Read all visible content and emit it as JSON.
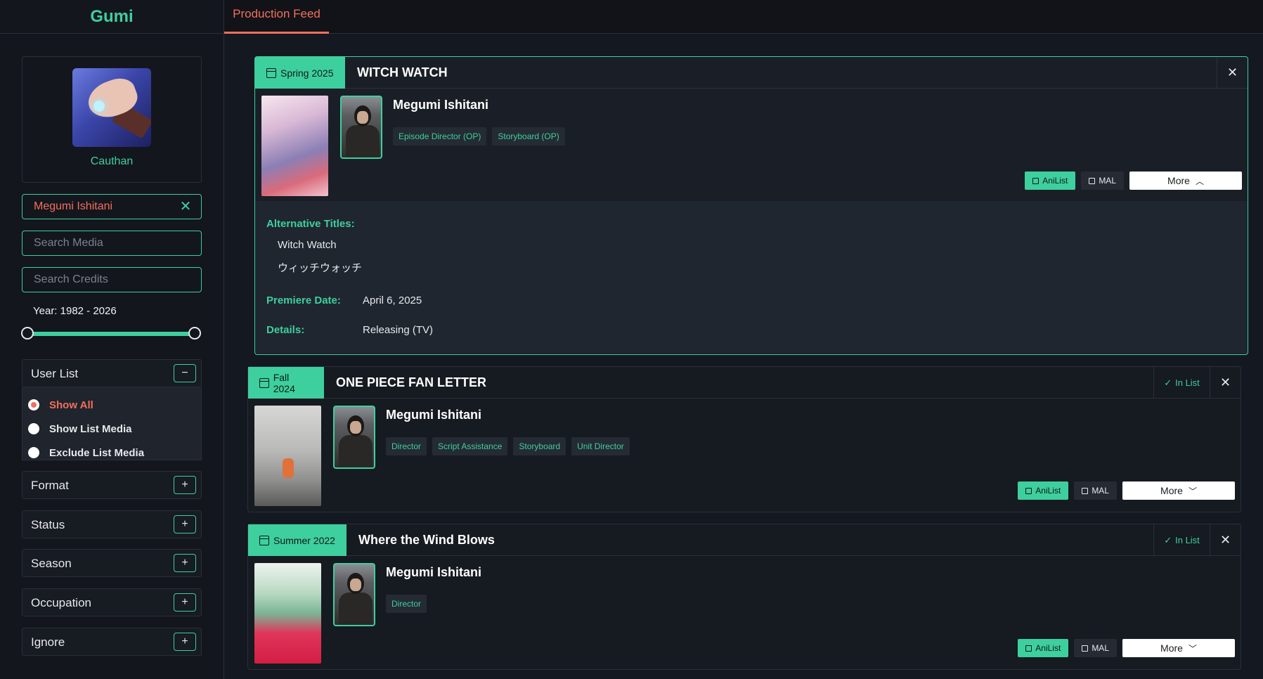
{
  "app": {
    "brand": "Gumi"
  },
  "tabs": [
    {
      "label": "Production Feed",
      "active": true
    }
  ],
  "profile": {
    "username": "Cauthan"
  },
  "filters": {
    "staff_value": "Megumi Ishitani",
    "search_media_placeholder": "Search Media",
    "search_credits_placeholder": "Search Credits",
    "year_label": "Year: 1982 - 2026",
    "year_min": 1982,
    "year_max": 2026
  },
  "user_list": {
    "title": "User List",
    "toggle": "−",
    "options": [
      {
        "label": "Show All",
        "selected": true
      },
      {
        "label": "Show List Media",
        "selected": false
      },
      {
        "label": "Exclude List Media",
        "selected": false
      }
    ]
  },
  "accordions": [
    {
      "title": "Format",
      "toggle": "+"
    },
    {
      "title": "Status",
      "toggle": "+"
    },
    {
      "title": "Season",
      "toggle": "+"
    },
    {
      "title": "Occupation",
      "toggle": "+"
    },
    {
      "title": "Ignore",
      "toggle": "+"
    }
  ],
  "colors": {
    "accent": "#3ecf9e",
    "highlight": "#f36f5b",
    "background": "#141820"
  },
  "cards": [
    {
      "season": "Spring 2025",
      "title": "WITCH WATCH",
      "in_list": false,
      "staff": "Megumi Ishitani",
      "roles": [
        "Episode Director (OP)",
        "Storyboard (OP)"
      ],
      "anilist": "AniList",
      "mal": "MAL",
      "more": "More",
      "expanded": true,
      "details": {
        "alt_label": "Alternative Titles:",
        "alt_titles": [
          "Witch Watch",
          "ウィッチウォッチ"
        ],
        "premiere_label": "Premiere Date:",
        "premiere_value": "April 6, 2025",
        "details_label": "Details:",
        "details_value": "Releasing (TV)"
      }
    },
    {
      "season": "Fall 2024",
      "title": "ONE PIECE FAN LETTER",
      "in_list": true,
      "in_list_label": "In List",
      "staff": "Megumi Ishitani",
      "roles": [
        "Director",
        "Script Assistance",
        "Storyboard",
        "Unit Director"
      ],
      "anilist": "AniList",
      "mal": "MAL",
      "more": "More",
      "expanded": false
    },
    {
      "season": "Summer 2022",
      "title": "Where the Wind Blows",
      "in_list": true,
      "in_list_label": "In List",
      "staff": "Megumi Ishitani",
      "roles": [
        "Director"
      ],
      "anilist": "AniList",
      "mal": "MAL",
      "more": "More",
      "expanded": false
    }
  ]
}
